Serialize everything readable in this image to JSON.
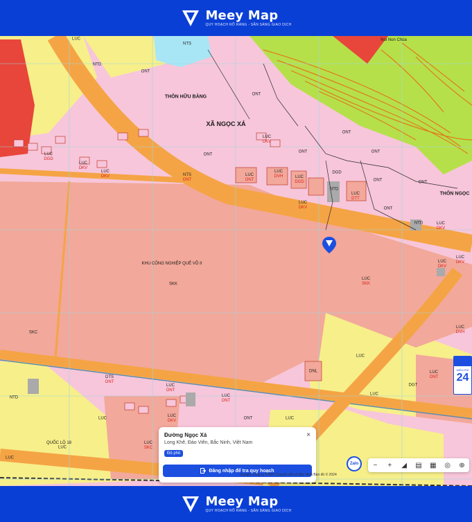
{
  "brand": {
    "name": "Meey Map",
    "tagline": "QUY HOẠCH RÕ RÀNG - SẴN SÀNG GIAO DỊCH"
  },
  "places": {
    "thon_huu_bang": "THÔN HỮU BẰNG",
    "xa_ngoc_xa": "XÃ NGỌC XÁ",
    "thon_ngoc": "THÔN NGỌC",
    "nui_non_chua": "Núi Non Chùa",
    "khu_cn": "KHU CÔNG NGHIỆP QUẾ VÕ II",
    "quoc_lo": "QUỐC LỘ 18"
  },
  "zones": [
    {
      "a": "LUC",
      "b": ""
    },
    {
      "a": "NTS",
      "b": ""
    },
    {
      "a": "ONT",
      "b": ""
    },
    {
      "a": "NTD",
      "b": ""
    },
    {
      "a": "LUC",
      "b": "DKV"
    },
    {
      "a": "LUC",
      "b": "DGD"
    },
    {
      "a": "ONT",
      "b": ""
    },
    {
      "a": "ONT",
      "b": ""
    },
    {
      "a": "NTS",
      "b": "ONT"
    },
    {
      "a": "LUC",
      "b": "ONT"
    },
    {
      "a": "LUC",
      "b": "DVH"
    },
    {
      "a": "LUC",
      "b": "DGD"
    },
    {
      "a": "ONT",
      "b": ""
    },
    {
      "a": "DGD",
      "b": ""
    },
    {
      "a": "NTD",
      "b": ""
    },
    {
      "a": "LUC",
      "b": "DTT"
    },
    {
      "a": "LUC",
      "b": "DKV"
    },
    {
      "a": "ONT",
      "b": ""
    },
    {
      "a": "ONT",
      "b": ""
    },
    {
      "a": "ONT",
      "b": ""
    },
    {
      "a": "NTD",
      "b": ""
    },
    {
      "a": "LUC",
      "b": "DKV"
    },
    {
      "a": "ONT",
      "b": ""
    },
    {
      "a": "SKK",
      "b": ""
    },
    {
      "a": "LUC",
      "b": "SKK"
    },
    {
      "a": "SKC",
      "b": ""
    },
    {
      "a": "LUC",
      "b": ""
    },
    {
      "a": "LUC",
      "b": ""
    },
    {
      "a": "DNL",
      "b": ""
    },
    {
      "a": "LUC",
      "b": "DKV"
    },
    {
      "a": "LUC",
      "b": ""
    },
    {
      "a": "LUC",
      "b": ""
    },
    {
      "a": "NTD",
      "b": ""
    },
    {
      "a": "DTS",
      "b": "ONT"
    },
    {
      "a": "LUC",
      "b": "ONT"
    },
    {
      "a": "LUC",
      "b": "ONT"
    },
    {
      "a": "ONT",
      "b": ""
    },
    {
      "a": "LUC",
      "b": "DKV"
    },
    {
      "a": "LUC",
      "b": "SKC"
    },
    {
      "a": "LUC",
      "b": ""
    },
    {
      "a": "LUC",
      "b": ""
    },
    {
      "a": "DGT",
      "b": ""
    },
    {
      "a": "LUC",
      "b": "DKV"
    },
    {
      "a": "LUC",
      "b": "DVH"
    },
    {
      "a": "LUC",
      "b": "DKV"
    },
    {
      "a": "ONT",
      "b": ""
    },
    {
      "a": "LUC",
      "b": "DKV"
    },
    {
      "a": "LUC",
      "b": "ONT"
    }
  ],
  "info_card": {
    "title": "Đường Ngọc Xá",
    "address": "Long Khê, Đào Viên, Bắc Ninh, Việt Nam",
    "badge": "Độ phủ",
    "close_icon": "×",
    "login_label": "Đăng nhập để tra quy hoạch"
  },
  "zalo_label": "Zalo",
  "toolbar": {
    "minus": "−",
    "plus": "+",
    "ruler": "◢",
    "layers": "▤",
    "grid": "▦",
    "compass": "◎",
    "target": "⊕"
  },
  "attribution": "Google  Công ty TNHH Chuyển đổi số Bắc Ninh   Bản đồ © 2024",
  "sign": {
    "sub": "MIỀN PHÍ",
    "num": "24"
  },
  "colors": {
    "brand_blue": "#0a3fd6",
    "residential": "#f7c6da",
    "industrial": "#f2a89a",
    "agriculture": "#f7ef8a",
    "road": "#f5a445",
    "forest": "#b6e04a",
    "contour": "#e07a1c"
  }
}
